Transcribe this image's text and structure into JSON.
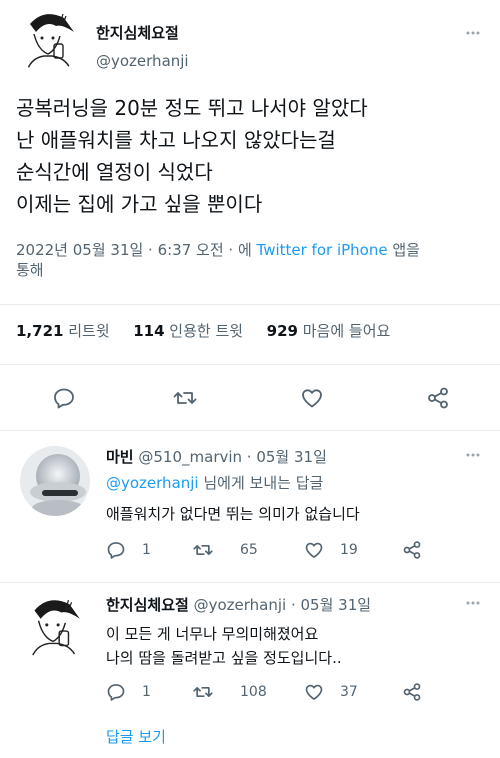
{
  "main_tweet": {
    "author_name": "한지심체요절",
    "handle": "@yozerhanji",
    "lines": [
      "공복러닝을 20분 정도 뛰고 나서야 알았다",
      "난 애플워치를 차고 나오지 않았다는걸",
      "순식간에 열정이 식었다",
      "이제는 집에 가고 싶을 뿐이다"
    ],
    "meta_time": "2022년 05월 31일 · 6:37 오전 · 에 ",
    "meta_app": "Twitter for iPhone",
    "meta_suffix": " 앱을",
    "meta_line2": "통해",
    "stats": {
      "retweets_count": "1,721",
      "retweets_label": "리트윗",
      "quotes_count": "114",
      "quotes_label": "인용한 트윗",
      "likes_count": "929",
      "likes_label": "마음에 들어요"
    }
  },
  "replies": [
    {
      "author_name": "마빈",
      "handle_date": "@510_marvin · 05월 31일",
      "replying_to_handle": "@yozerhanji",
      "replying_to_suffix": " 님에게 보내는 답글",
      "text_lines": [
        "애플워치가 없다면 뛰는 의미가 없습니다"
      ],
      "replies_count": "1",
      "retweets_count": "65",
      "likes_count": "19"
    },
    {
      "author_name": "한지심체요절",
      "handle_date": "@yozerhanji · 05월 31일",
      "text_lines": [
        "이 모든 게 너무나 무의미해졌어요",
        "나의 땀을 돌려받고 싶을 정도입니다.."
      ],
      "replies_count": "1",
      "retweets_count": "108",
      "likes_count": "37",
      "show_replies_label": "답글 보기"
    }
  ],
  "colors": {
    "accent": "#1d9bf0",
    "text": "#0f1419",
    "muted": "#536471",
    "divider": "#e6ecf0"
  },
  "icons": [
    "more-icon",
    "reply-icon",
    "retweet-icon",
    "like-icon",
    "share-icon"
  ]
}
